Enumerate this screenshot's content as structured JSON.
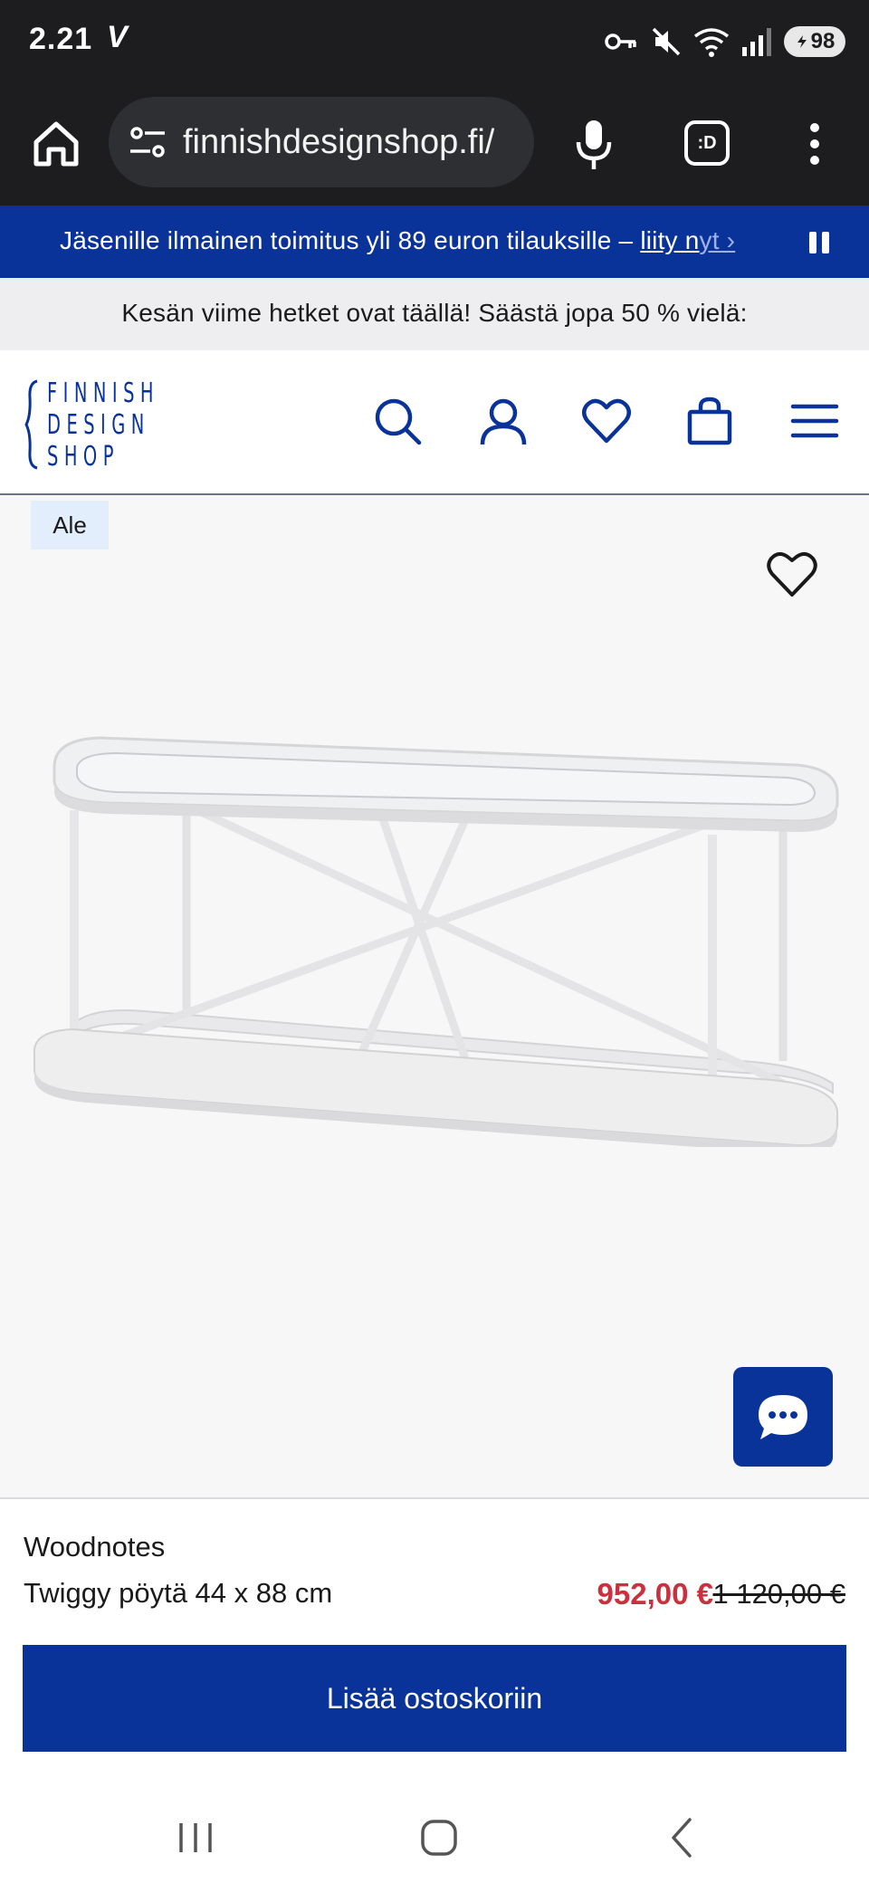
{
  "status_bar": {
    "time": "2.21",
    "carrier_glyph": "V",
    "battery": "98",
    "icons": [
      "vpn-key-icon",
      "mute-icon",
      "wifi-icon",
      "signal-icon",
      "battery-icon"
    ]
  },
  "browser": {
    "url": "finnishdesignshop.fi/",
    "tab_label": ":D",
    "icons": [
      "home-icon",
      "site-settings-icon",
      "mic-icon",
      "tab-switcher-icon",
      "more-vert-icon"
    ]
  },
  "promo": {
    "text": "Jäsenille ilmainen toimitus yli 89 euron tilauksille – ",
    "link_label": "liity n",
    "link_fade": "yt ›"
  },
  "sale_banner": {
    "text": "Kesän viime hetket ovat täällä! Säästä jopa 50 % vielä:"
  },
  "header": {
    "logo_lines": [
      "FINNISH",
      "DESIGN",
      "SHOP"
    ],
    "icons": [
      "search-icon",
      "account-icon",
      "wishlist-icon",
      "cart-icon",
      "menu-icon"
    ],
    "brand_color": "#0a3399"
  },
  "product": {
    "badge": "Ale",
    "brand": "Woodnotes",
    "name": "Twiggy pöytä 44 x 88 cm",
    "price_now": "952,00 €",
    "price_was": "1 120,00 €",
    "add_to_cart": "Lisää ostoskoriin",
    "sale_color": "#c8313d"
  },
  "nav": {
    "icons": [
      "recents-icon",
      "home-button-icon",
      "back-icon"
    ]
  }
}
